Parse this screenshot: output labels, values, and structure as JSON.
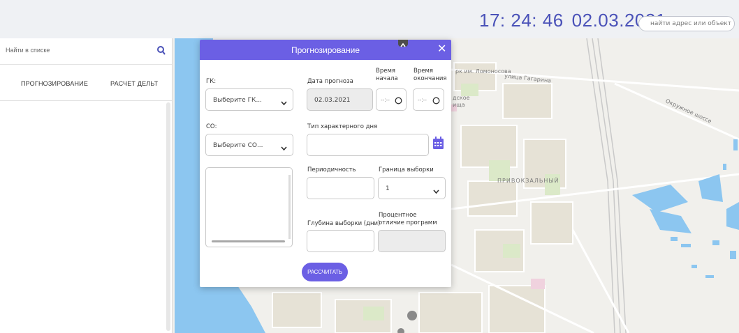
{
  "header": {
    "clock_time": "17: 24: 46",
    "clock_date": "02.03.2021",
    "search_placeholder": "найти адрес или объект"
  },
  "left_panel": {
    "search_placeholder": "Найти в списке",
    "tabs": [
      "ПРОГНОЗИРОВАНИЕ",
      "РАСЧЕТ ДЕЛЬТ"
    ]
  },
  "dialog": {
    "title": "Прогнозирование",
    "close_glyph": "✕",
    "gk_label": "ГК:",
    "gk_value": "Выберите ГК...",
    "forecast_date_label": "Дата прогноза",
    "forecast_date_value": "02.03.2021",
    "start_time_label": "Время начала",
    "end_time_label": "Время окончания",
    "time_placeholder": "--:--",
    "so_label": "СО:",
    "so_value": "Выберите СО...",
    "day_type_label": "Тип характерного дня",
    "periodicity_label": "Периодичность",
    "sample_bound_label": "Граница выборки",
    "sample_bound_value": "1",
    "sample_depth_label": "Глубина выборки (дни)",
    "percent_diff_label": "Процентное отличие программ",
    "calculate_button": "РАССЧИТАТЬ"
  },
  "map": {
    "labels": [
      "рк им. Ломоносова",
      "улица Гагарина",
      "ПРИВОКЗАЛЬНЫЙ",
      "Окружное шоссе",
      "дское",
      "ища"
    ]
  },
  "colors": {
    "accent": "#6b5fe4",
    "clock": "#4a52b8",
    "water": "#8cc6f0"
  },
  "icons": [
    "search-icon",
    "close-icon",
    "chevron-down-icon",
    "clock-icon",
    "calendar-icon",
    "collapse-arrow-icon"
  ]
}
